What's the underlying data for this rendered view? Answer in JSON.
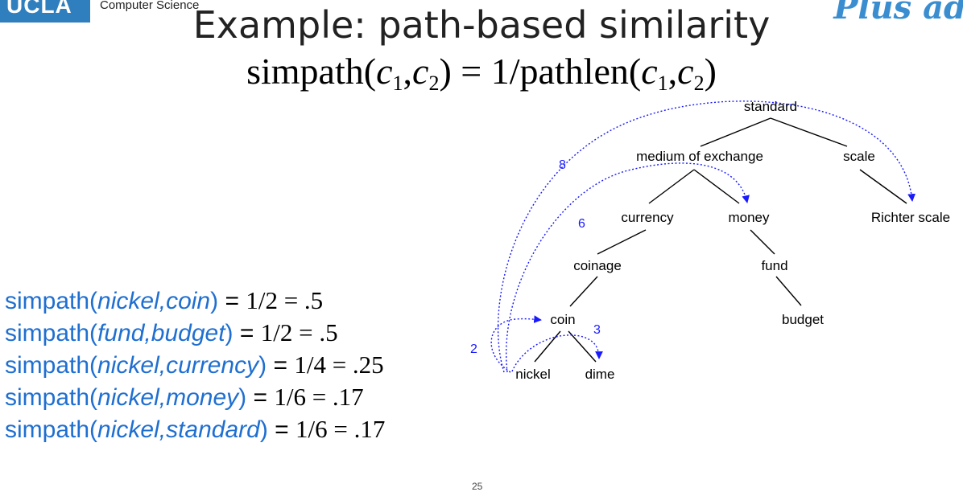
{
  "header": {
    "dept": "Computer Science",
    "brand": "Plus ad"
  },
  "slide": {
    "title": "Example: path-based similarity",
    "formula": {
      "lhs": "simpath",
      "rhs": "1/pathlen",
      "c1": "c",
      "c1_sub": "1",
      "c2": "c",
      "c2_sub": "2"
    },
    "page_number": "25"
  },
  "tree": {
    "nodes": {
      "standard": "standard",
      "medium": "medium of exchange",
      "scale": "scale",
      "currency": "currency",
      "money": "money",
      "richter": "Richter scale",
      "coinage": "coinage",
      "fund": "fund",
      "coin": "coin",
      "budget": "budget",
      "nickel": "nickel",
      "dime": "dime"
    },
    "path_lengths": {
      "standard": "8",
      "money": "6",
      "dime": "3",
      "coin": "2"
    },
    "path_color": "#1a1aff"
  },
  "examples": [
    {
      "fn": "simpath(",
      "a": "nickel,coin",
      "close": ")",
      "eq": " = ",
      "val": "1/2 = .5"
    },
    {
      "fn": "simpath(",
      "a": "fund,budget",
      "close": ")",
      "eq": " = ",
      "val": "1/2 = .5"
    },
    {
      "fn": "simpath(",
      "a": "nickel,currency",
      "close": ")",
      "eq": " = ",
      "val": "1/4 = .25"
    },
    {
      "fn": "simpath(",
      "a": "nickel,money",
      "close": ")",
      "eq": " = ",
      "val": "1/6 = .17"
    },
    {
      "fn": "simpath(",
      "a": "nickel,standard",
      "close": ")",
      "eq": " = ",
      "val": "1/6 = .17"
    }
  ]
}
